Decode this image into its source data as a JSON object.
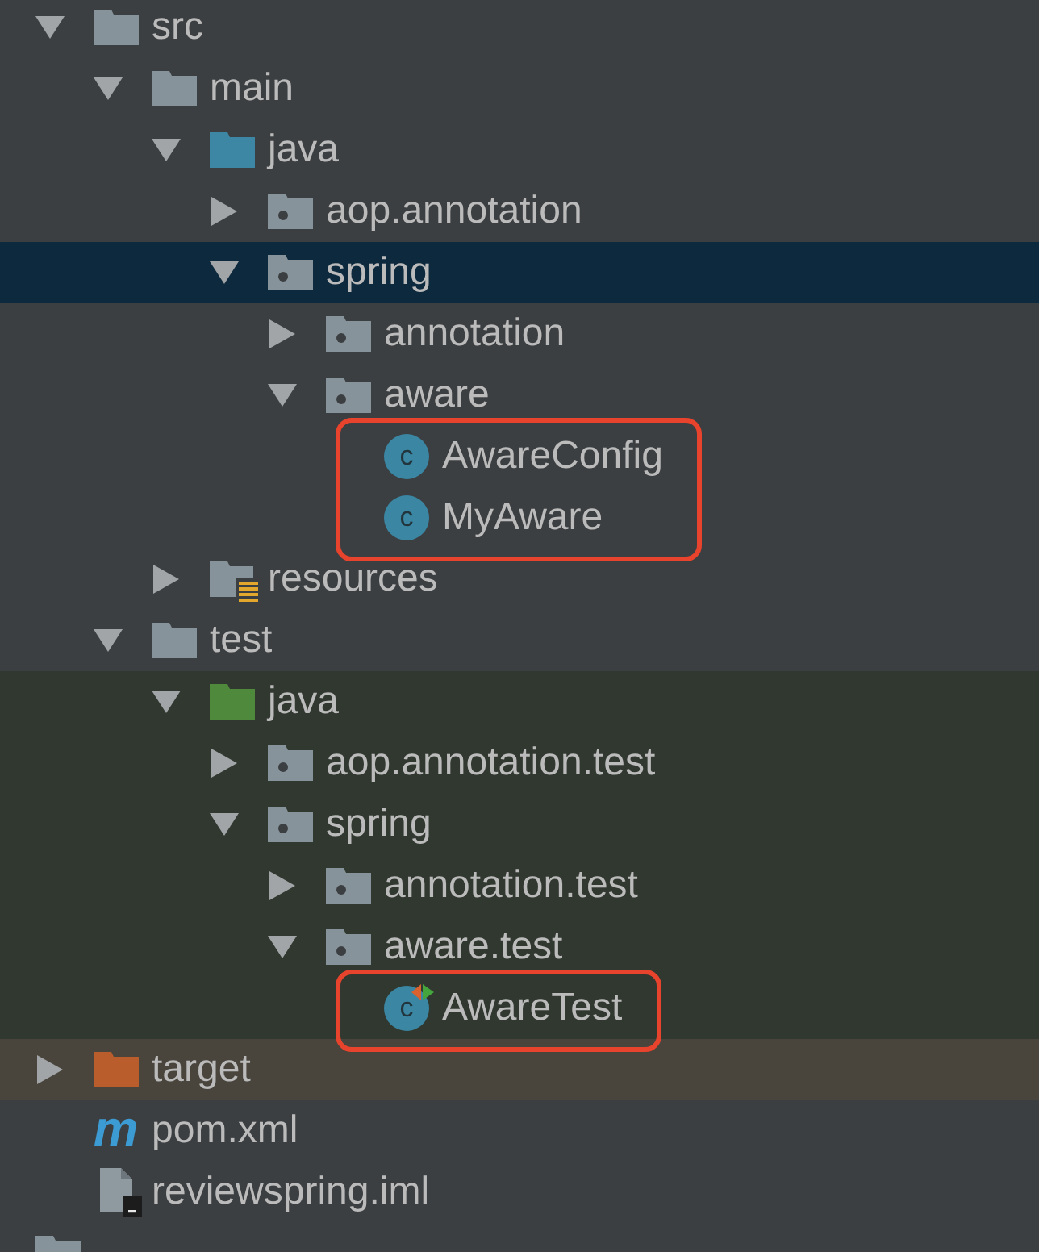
{
  "tree": {
    "children": [
      {
        "kind": "folder",
        "name": "src",
        "expanded": true,
        "selected": false,
        "children": [
          {
            "kind": "folder",
            "name": "main",
            "expanded": true,
            "selected": false,
            "children": [
              {
                "kind": "source_root",
                "name": "java",
                "expanded": true,
                "selected": false,
                "children": [
                  {
                    "kind": "package",
                    "name": "aop.annotation",
                    "expanded": false,
                    "selected": false
                  },
                  {
                    "kind": "package",
                    "name": "spring",
                    "expanded": true,
                    "selected": true,
                    "children": [
                      {
                        "kind": "package",
                        "name": "annotation",
                        "expanded": false,
                        "selected": false
                      },
                      {
                        "kind": "package",
                        "name": "aware",
                        "expanded": true,
                        "selected": false,
                        "children": [
                          {
                            "kind": "class",
                            "name": "AwareConfig",
                            "icon_letter": "c",
                            "selected": false,
                            "boxed": true
                          },
                          {
                            "kind": "class",
                            "name": "MyAware",
                            "icon_letter": "c",
                            "selected": false,
                            "boxed": true
                          }
                        ]
                      }
                    ]
                  }
                ]
              },
              {
                "kind": "resources_root",
                "name": "resources",
                "expanded": false,
                "selected": false
              }
            ]
          },
          {
            "kind": "folder",
            "name": "test",
            "expanded": true,
            "selected": false,
            "children": [
              {
                "kind": "test_root",
                "name": "java",
                "expanded": true,
                "selected": false,
                "children": [
                  {
                    "kind": "package",
                    "name": "aop.annotation.test",
                    "expanded": false,
                    "selected": false
                  },
                  {
                    "kind": "package",
                    "name": "spring",
                    "expanded": true,
                    "selected": false,
                    "children": [
                      {
                        "kind": "package",
                        "name": "annotation.test",
                        "expanded": false,
                        "selected": false
                      },
                      {
                        "kind": "package",
                        "name": "aware.test",
                        "expanded": true,
                        "selected": false,
                        "children": [
                          {
                            "kind": "test_class",
                            "name": "AwareTest",
                            "icon_letter": "c",
                            "selected": false,
                            "boxed": true
                          }
                        ]
                      }
                    ]
                  }
                ]
              }
            ]
          }
        ]
      },
      {
        "kind": "excluded",
        "name": "target",
        "expanded": false,
        "selected": false
      },
      {
        "kind": "maven_file",
        "name": "pom.xml",
        "icon_letter": "m",
        "selected": false
      },
      {
        "kind": "module_file",
        "name": "reviewspring.iml",
        "selected": false
      }
    ],
    "outer_items": [
      {
        "kind": "folder",
        "selected": false
      }
    ]
  }
}
